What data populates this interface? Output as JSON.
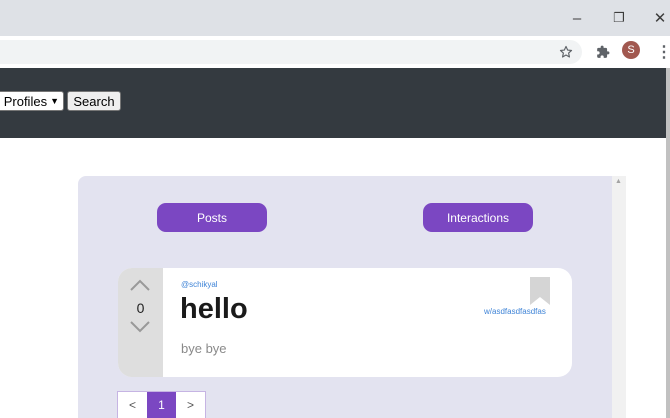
{
  "browser": {
    "window_controls": {
      "minimize": "–",
      "restore": "❐",
      "close": "✕"
    },
    "toolbar": {
      "bookmark_icon": "star-icon",
      "extensions_icon": "puzzle-icon",
      "profile_initial": "S",
      "menu_icon": "⋮"
    }
  },
  "navbar": {
    "search_type_value": "Profiles",
    "search_button": "Search"
  },
  "tabs": {
    "posts": "Posts",
    "interactions": "Interactions"
  },
  "post": {
    "votes": "0",
    "author": "@schikyal",
    "title": "hello",
    "body": "bye bye",
    "community": "w/asdfasdfasdfas"
  },
  "pagination": {
    "prev": "<",
    "current": "1",
    "next": ">"
  },
  "colors": {
    "accent": "#7b47c2",
    "navbar": "#343a40",
    "panel": "#e3e3f0",
    "link": "#3f84d7"
  }
}
